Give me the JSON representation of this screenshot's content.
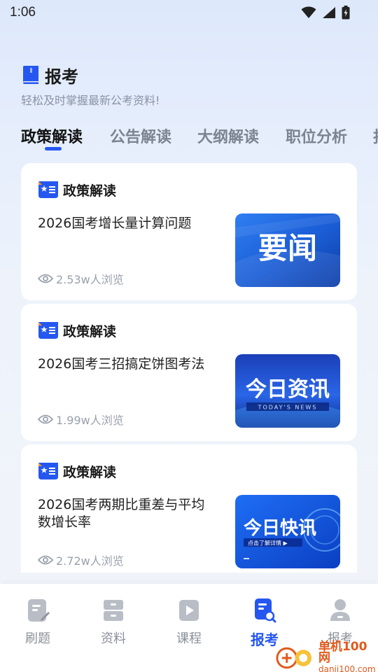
{
  "status_bar": {
    "time": "1:06"
  },
  "header": {
    "title": "报考",
    "subtitle": "轻松及时掌握最新公考资料!"
  },
  "tabs": [
    {
      "label": "政策解读",
      "active": true
    },
    {
      "label": "公告解读",
      "active": false
    },
    {
      "label": "大纲解读",
      "active": false
    },
    {
      "label": "职位分析",
      "active": false
    },
    {
      "label": "报",
      "active": false
    }
  ],
  "cards": [
    {
      "category": "政策解读",
      "title": "2026国考增长量计算问题",
      "views": "2.53w人浏览",
      "image_text": "要闻"
    },
    {
      "category": "政策解读",
      "title": "2026国考三招搞定饼图考法",
      "views": "1.99w人浏览",
      "image_text": "今日资讯",
      "image_subtext": "TODAY'S NEWS"
    },
    {
      "category": "政策解读",
      "title": "2026国考两期比重差与平均数增长率",
      "views": "2.72w人浏览",
      "image_text": "今日快讯",
      "image_subtext": "点击了解详情 ▶"
    }
  ],
  "bottom_nav": [
    {
      "label": "刷题",
      "icon": "edit-note-icon",
      "active": false
    },
    {
      "label": "资料",
      "icon": "folder-icon",
      "active": false
    },
    {
      "label": "课程",
      "icon": "play-icon",
      "active": false
    },
    {
      "label": "报考",
      "icon": "search-doc-icon",
      "active": true
    },
    {
      "label": "报考",
      "icon": "person-icon",
      "active": false
    }
  ],
  "watermark": {
    "name": "单机100网",
    "url": "danji100.com"
  },
  "colors": {
    "accent": "#2557f0",
    "inactive": "#8a8f99"
  }
}
